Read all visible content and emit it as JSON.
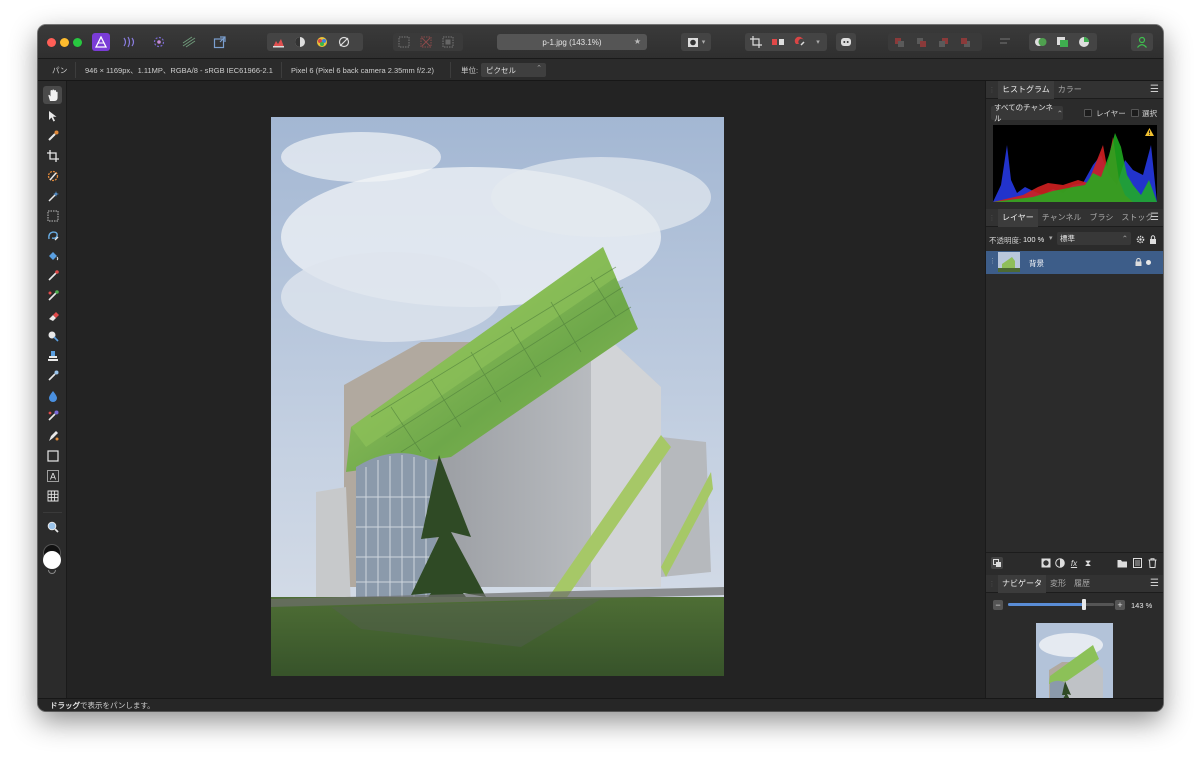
{
  "toolbar": {
    "document_title": "p-1.jpg (143.1%)",
    "title_star": "★",
    "mode_dropdown_arrow": "▾"
  },
  "context_bar": {
    "tool_name": "パン",
    "image_info": "946 × 1169px、1.11MP、RGBA/8 - sRGB IEC61966-2.1",
    "camera_info": "Pixel 6 (Pixel 6 back camera 2.35mm f/2.2)",
    "unit_label": "単位:",
    "unit_value": "ピクセル",
    "unit_arrow": "⌃"
  },
  "histogram_panel": {
    "tabs": [
      {
        "label": "ヒストグラム",
        "active": true
      },
      {
        "label": "カラー",
        "active": false
      }
    ],
    "channel_select": "すべてのチャンネル",
    "layer_checkbox_label": "レイヤー",
    "selection_checkbox_label": "選択",
    "warning_icon": "warning-triangle-icon"
  },
  "layers_panel": {
    "tabs": [
      {
        "label": "レイヤー",
        "active": true
      },
      {
        "label": "チャンネル",
        "active": false
      },
      {
        "label": "ブラシ",
        "active": false
      },
      {
        "label": "ストック",
        "active": false
      }
    ],
    "opacity_label": "不透明度:",
    "opacity_value": "100 %",
    "blend_mode": "標準",
    "layers": [
      {
        "name": "背景",
        "locked": true,
        "visible": true,
        "selected": true
      }
    ]
  },
  "navigator_panel": {
    "tabs": [
      {
        "label": "ナビゲータ",
        "active": true
      },
      {
        "label": "変形",
        "active": false
      },
      {
        "label": "履歴",
        "active": false
      }
    ],
    "zoom_value": "143 %",
    "zoom_level": 0.72,
    "minus_label": "−",
    "plus_label": "+"
  },
  "status_bar": {
    "bold_text": "ドラッグ",
    "text": "で表示をパンします。"
  },
  "colors": {
    "accent_blue": "#3d5d89",
    "affinity_purple": "#7a3cd6",
    "close": "#ff5f57",
    "minimize": "#febc2e",
    "zoom": "#28c840"
  }
}
